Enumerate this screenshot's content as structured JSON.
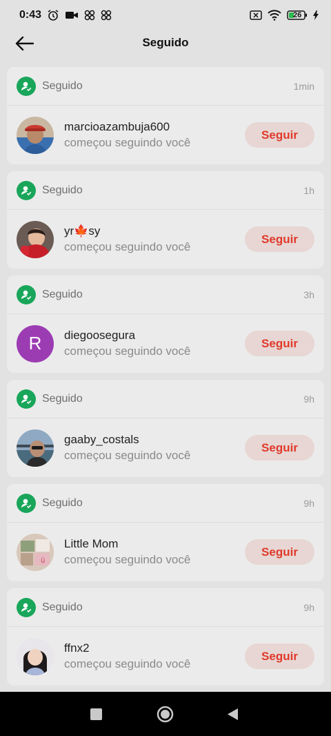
{
  "status_bar": {
    "time": "0:43",
    "battery": "26"
  },
  "header": {
    "title": "Seguido"
  },
  "notifications": [
    {
      "type_label": "Seguido",
      "time": "1min",
      "username": "marcioazambuja600",
      "message": "começou seguindo você",
      "button": "Seguir",
      "avatar": "photo-man-cap"
    },
    {
      "type_label": "Seguido",
      "time": "1h",
      "username": "yr🍁sy",
      "message": "começou seguindo você",
      "button": "Seguir",
      "avatar": "photo-child-red"
    },
    {
      "type_label": "Seguido",
      "time": "3h",
      "username": "diegoosegura",
      "message": "começou seguindo você",
      "button": "Seguir",
      "avatar_letter": "R"
    },
    {
      "type_label": "Seguido",
      "time": "9h",
      "username": "gaaby_costals",
      "message": "começou seguindo você",
      "button": "Seguir",
      "avatar": "photo-seaside"
    },
    {
      "type_label": "Seguido",
      "time": "9h",
      "username": "Little Mom",
      "message": "começou seguindo você",
      "button": "Seguir",
      "avatar": "photo-collage"
    },
    {
      "type_label": "Seguido",
      "time": "9h",
      "username": "ffnx2",
      "message": "começou seguindo você",
      "button": "Seguir",
      "avatar": "photo-woman"
    }
  ],
  "colors": {
    "accent": "#e0392b",
    "badge": "#19a65a",
    "avatar_letter_bg": "#9c3cb3"
  }
}
